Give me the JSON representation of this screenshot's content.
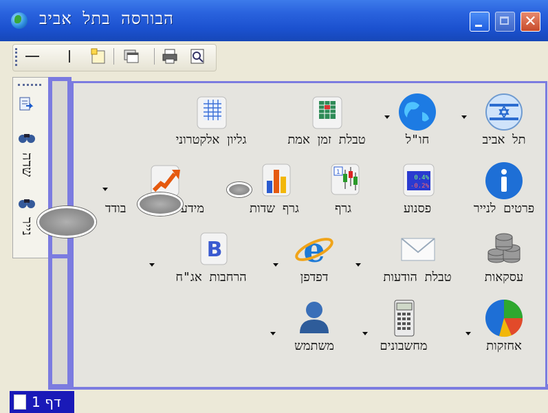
{
  "window": {
    "title": "הבורסה בתל אביב"
  },
  "left_tabs": [
    {
      "label": "שדה"
    },
    {
      "label": "נייר"
    }
  ],
  "content": {
    "items": [
      {
        "label": "תל אביב",
        "icon": "israel-flag-icon"
      },
      {
        "label": "חו\"ל",
        "icon": "globe-icon"
      },
      {
        "label": "טבלת זמן אמת",
        "icon": "realtime-table-icon"
      },
      {
        "label": "גליון אלקטרוני",
        "icon": "spreadsheet-icon"
      },
      {
        "label": "פרטים לנייר",
        "icon": "info-icon"
      },
      {
        "label": "פסנוע",
        "icon": "ticker-icon",
        "ticker_up": "0.4%",
        "ticker_down": "-0.2%"
      },
      {
        "label": "גרף",
        "icon": "candlestick-icon"
      },
      {
        "label": "גרף שדות",
        "icon": "bar-graph-icon"
      },
      {
        "label": "מידע לנ",
        "label2": "בודד",
        "icon": "trend-arrow-icon"
      },
      {
        "label": "עסקאות",
        "icon": "coins-icon"
      },
      {
        "label": "טבלת הודעות",
        "icon": "envelope-icon"
      },
      {
        "label": "דפדפן",
        "icon": "browser-icon"
      },
      {
        "label": "הרחבות אג\"ח",
        "icon": "bonds-icon"
      },
      {
        "label": "אחזקות",
        "icon": "pie-chart-icon"
      },
      {
        "label": "מחשבונים",
        "icon": "calculator-icon"
      },
      {
        "label": "משתמש",
        "icon": "user-icon"
      }
    ]
  },
  "status": {
    "page_label": "דף 1"
  }
}
